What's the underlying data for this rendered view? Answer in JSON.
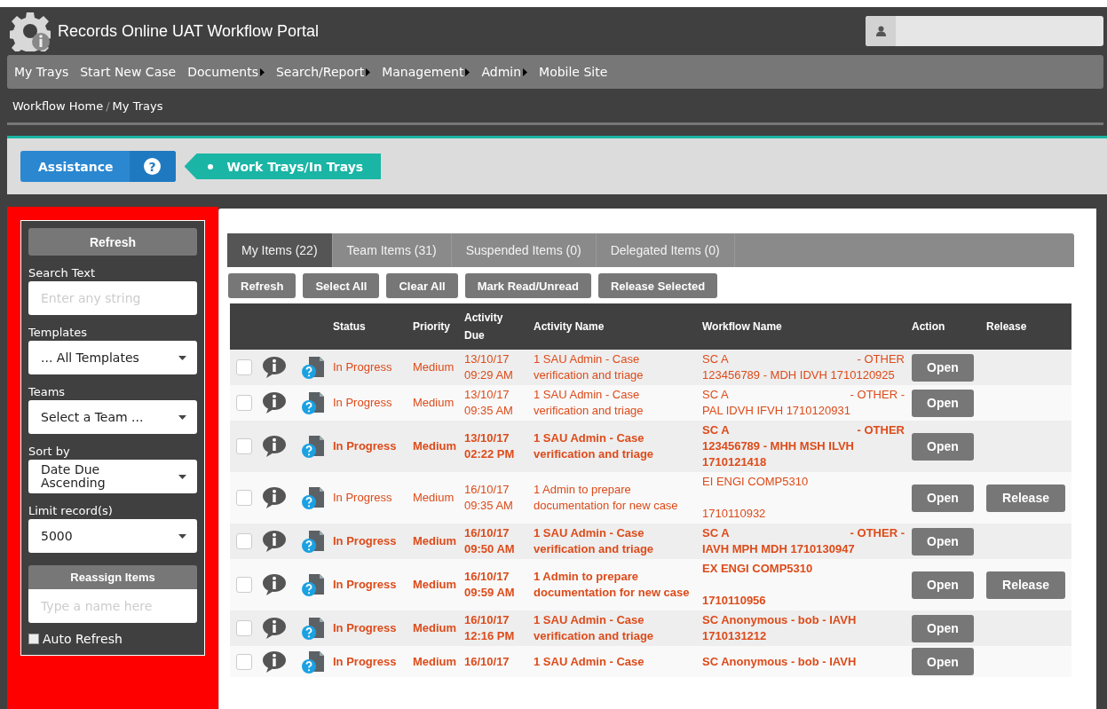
{
  "header": {
    "title": "Records Online UAT Workflow Portal"
  },
  "nav": [
    {
      "label": "My Trays",
      "submenu": false
    },
    {
      "label": "Start New Case",
      "submenu": false
    },
    {
      "label": "Documents",
      "submenu": true
    },
    {
      "label": "Search/Report",
      "submenu": true
    },
    {
      "label": "Management",
      "submenu": true
    },
    {
      "label": "Admin",
      "submenu": true
    },
    {
      "label": "Mobile Site",
      "submenu": false
    }
  ],
  "breadcrumb": {
    "separator": "/",
    "items": [
      "Workflow Home",
      "My Trays"
    ]
  },
  "assistance": {
    "label": "Assistance",
    "help": "?",
    "page_tag": "Work Trays/In Trays"
  },
  "sidebar": {
    "refresh": "Refresh",
    "search_label": "Search Text",
    "search_placeholder": "Enter any string",
    "selects": [
      {
        "label": "Templates",
        "value": "... All Templates"
      },
      {
        "label": "Teams",
        "value": "Select a Team ..."
      },
      {
        "label": "Sort by",
        "value": "Date Due Ascending"
      },
      {
        "label": "Limit record(s)",
        "value": "5000"
      }
    ],
    "reassign": "Reassign Items",
    "reassign_placeholder": "Type a name here",
    "auto_refresh": {
      "label": "Auto Refresh",
      "checked": false
    }
  },
  "tabs": [
    {
      "label": "My Items (22)",
      "selected": true
    },
    {
      "label": "Team Items (31)",
      "selected": false
    },
    {
      "label": "Suspended Items (0)",
      "selected": false
    },
    {
      "label": "Delegated Items (0)",
      "selected": false
    }
  ],
  "toolbar": [
    "Refresh",
    "Select All",
    "Clear All",
    "Mark Read/Unread",
    "Release Selected"
  ],
  "table": {
    "columns": [
      "Status",
      "Priority",
      "Activity Due",
      "Activity Name",
      "Workflow Name",
      "Action",
      "Release"
    ],
    "rows": [
      {
        "checked": false,
        "unread": false,
        "status": "In Progress",
        "priority": "Medium",
        "due": [
          "13/10/17",
          "09:29 AM"
        ],
        "activity": "1 SAU Admin - Case verification and triage",
        "workflow": {
          "head": "SC A",
          "tag": "- OTHER",
          "body": "123456789 - MDH IDVH 1710120925"
        },
        "action": "Open"
      },
      {
        "checked": false,
        "unread": false,
        "status": "In Progress",
        "priority": "Medium",
        "due": [
          "13/10/17",
          "09:35 AM"
        ],
        "activity": "1 SAU Admin - Case verification and triage",
        "workflow": {
          "head": "SC A",
          "tag": "- OTHER -",
          "body": "PAL IDVH IFVH 1710120931"
        },
        "action": "Open"
      },
      {
        "checked": false,
        "unread": true,
        "status": "In Progress",
        "priority": "Medium",
        "due": [
          "13/10/17",
          "02:22 PM"
        ],
        "activity": "1 SAU Admin - Case verification and triage",
        "workflow": {
          "head": "SC A",
          "tag": "- OTHER",
          "body": "123456789 - MHH MSH ILVH 1710121418"
        },
        "action": "Open"
      },
      {
        "checked": false,
        "unread": false,
        "status": "In Progress",
        "priority": "Medium",
        "due": [
          "16/10/17",
          "09:35 AM"
        ],
        "activity": "1 Admin to prepare documentation for new case",
        "workflow": {
          "head": "EI ENGI COMP5310",
          "blank_line": true,
          "body": "1710110932"
        },
        "action": "Open",
        "release": "Release"
      },
      {
        "checked": false,
        "unread": true,
        "status": "In Progress",
        "priority": "Medium",
        "due": [
          "16/10/17",
          "09:50 AM"
        ],
        "activity": "1 SAU Admin - Case verification and triage",
        "workflow": {
          "head": "SC A",
          "tag": "- OTHER -",
          "body": "IAVH MPH MDH 1710130947"
        },
        "action": "Open"
      },
      {
        "checked": false,
        "unread": true,
        "status": "In Progress",
        "priority": "Medium",
        "due": [
          "16/10/17",
          "09:59 AM"
        ],
        "activity": "1 Admin to prepare documentation for new case",
        "workflow": {
          "head": "EX ENGI COMP5310",
          "blank_line": true,
          "body": "1710110956"
        },
        "action": "Open",
        "release": "Release"
      },
      {
        "checked": false,
        "unread": true,
        "status": "In Progress",
        "priority": "Medium",
        "due": [
          "16/10/17",
          "12:16 PM"
        ],
        "activity": "1 SAU Admin - Case verification and triage",
        "workflow": {
          "head": "SC Anonymous - bob - IAVH",
          "body": "1710131212"
        },
        "action": "Open"
      },
      {
        "checked": false,
        "unread": true,
        "status": "In Progress",
        "priority": "Medium",
        "due": [
          "16/10/17"
        ],
        "activity": "1 SAU Admin - Case",
        "workflow": {
          "head": "SC Anonymous - bob - IAVH"
        },
        "action": "Open"
      }
    ]
  }
}
